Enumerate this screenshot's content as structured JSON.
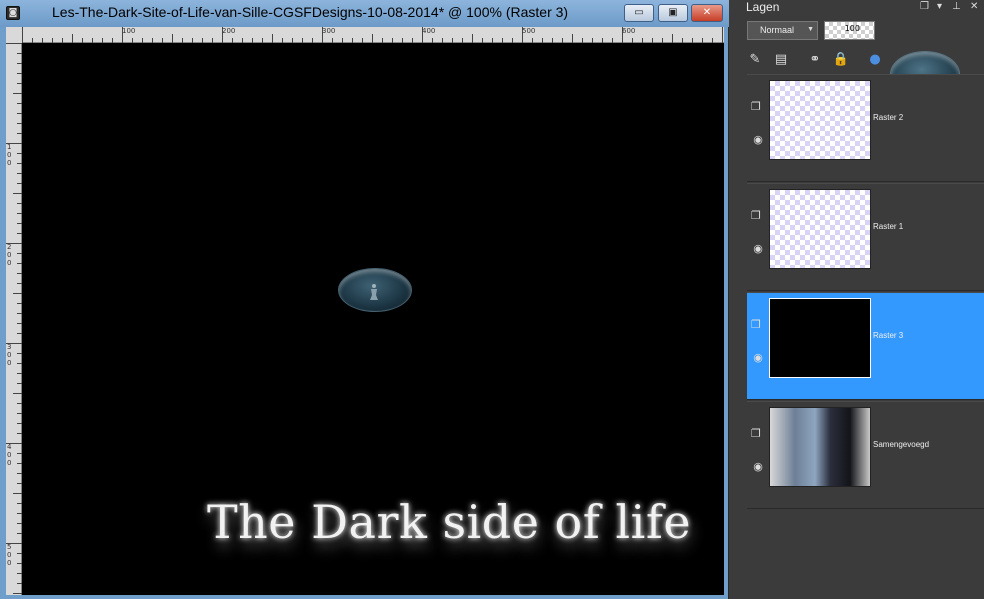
{
  "window": {
    "title": "Les-The-Dark-Site-of-Life-van-Sille-CGSFDesigns-10-08-2014* @ 100% (Raster 3)",
    "minimize_glyph": "▭",
    "maximize_glyph": "▣",
    "close_glyph": "✕"
  },
  "rulers": {
    "top_labels": [
      "100",
      "200",
      "300",
      "400",
      "500",
      "600"
    ],
    "left_labels": [
      "1\n0\n0",
      "2\n0\n0",
      "3\n0\n0",
      "4\n0\n0",
      "5\n0\n0"
    ]
  },
  "canvas": {
    "text": "The Dark side of life"
  },
  "panel": {
    "title": "Lagen",
    "blend_mode": "Normaal",
    "opacity": "100",
    "header_icons": [
      "restore-icon",
      "menu-arrow-icon",
      "pin-icon",
      "close-icon"
    ]
  },
  "layers": [
    {
      "name": "Raster 2",
      "selected": false,
      "thumb": "checker"
    },
    {
      "name": "Raster 1",
      "selected": false,
      "thumb": "checker"
    },
    {
      "name": "Raster 3",
      "selected": true,
      "thumb": "black"
    },
    {
      "name": "Samengevoegd",
      "selected": false,
      "thumb": "image"
    }
  ],
  "colors": {
    "selection": "#3399ff",
    "titlebar": "#6c9ac8"
  }
}
